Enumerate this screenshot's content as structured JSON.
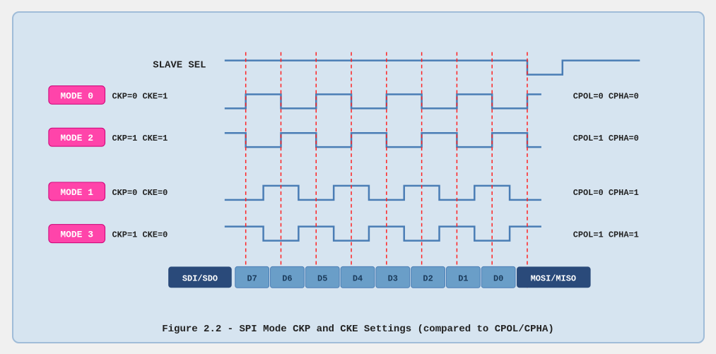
{
  "caption": "Figure 2.2 - SPI Mode CKP and CKE Settings (compared to CPOL/CPHA)",
  "title": "SPI Mode CKP and CKE Settings",
  "labels": {
    "slave_sel": "SLAVE SEL",
    "mode0": "MODE 0",
    "mode2": "MODE 2",
    "mode1": "MODE 1",
    "mode3": "MODE 3",
    "mode0_ckp": "CKP=0 CKE=1",
    "mode2_ckp": "CKP=1 CKE=1",
    "mode1_ckp": "CKP=0 CKE=0",
    "mode3_ckp": "CKP=1 CKE=0",
    "mode0_cpol": "CPOL=0 CPHA=0",
    "mode2_cpol": "CPOL=1 CPHA=0",
    "mode1_cpol": "CPOL=0 CPHA=1",
    "mode3_cpol": "CPOL=1 CPHA=1",
    "sdi_sdo": "SDI/SDO",
    "mosi_miso": "MOSI/MISO",
    "d7": "D7",
    "d6": "D6",
    "d5": "D5",
    "d4": "D4",
    "d3": "D3",
    "d2": "D2",
    "d1": "D1",
    "d0": "D0"
  },
  "colors": {
    "mode_badge": "#ff44aa",
    "mode_badge_border": "#cc0077",
    "waveform": "#4a7db5",
    "dashed_red": "#ff2222",
    "data_bar_dark": "#2a4a7a",
    "data_bar_light": "#6a9ec8",
    "slave_sel_line": "#4a7db5",
    "background": "#d6e4f0"
  }
}
